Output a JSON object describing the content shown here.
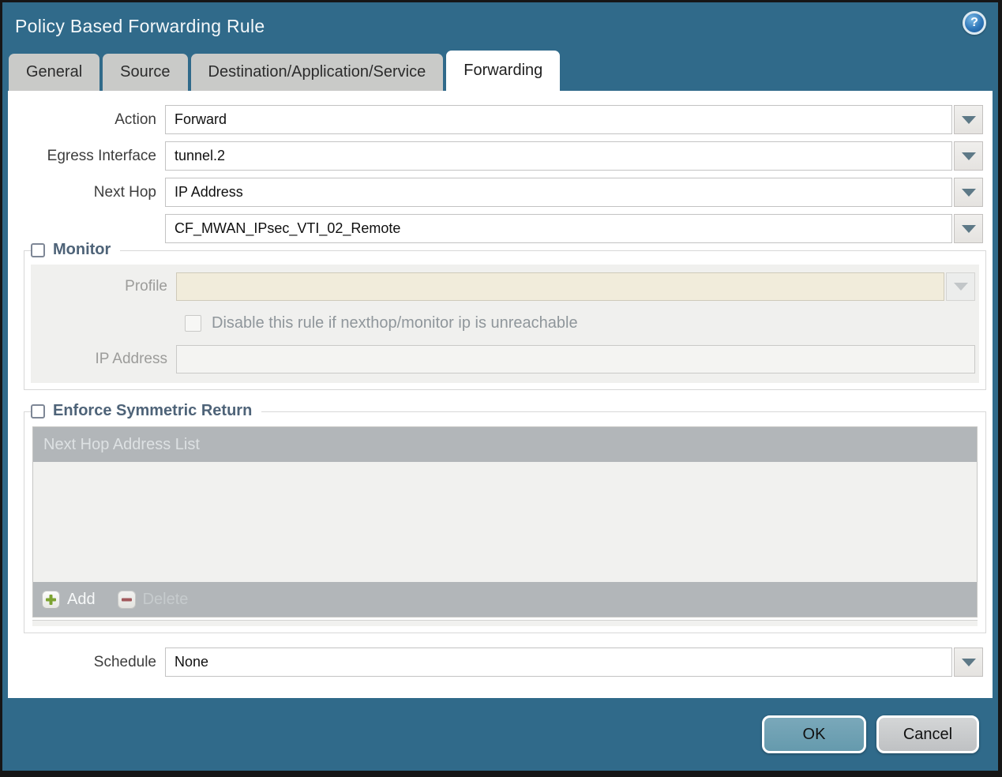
{
  "window": {
    "title": "Policy Based Forwarding Rule",
    "help_glyph": "?",
    "colors": {
      "chrome_teal": "#306a8a",
      "inactive_tab": "#c9cac8",
      "active_tab": "#ffffff",
      "table_header_gray": "#b2b6b9",
      "disabled_beige_field": "#f1ecdb",
      "ok_button": "#6fa1b4",
      "cancel_button": "#c8cacc",
      "legend_text": "#4e6378"
    }
  },
  "tabs": [
    {
      "label": "General",
      "active": false
    },
    {
      "label": "Source",
      "active": false
    },
    {
      "label": "Destination/Application/Service",
      "active": false
    },
    {
      "label": "Forwarding",
      "active": true
    }
  ],
  "form": {
    "action": {
      "label": "Action",
      "value": "Forward"
    },
    "egress_interface": {
      "label": "Egress Interface",
      "value": "tunnel.2"
    },
    "next_hop": {
      "label": "Next Hop",
      "value": "IP Address"
    },
    "next_hop_address": {
      "value": "CF_MWAN_IPsec_VTI_02_Remote"
    },
    "schedule": {
      "label": "Schedule",
      "value": "None"
    }
  },
  "monitor": {
    "legend": "Monitor",
    "checked": false,
    "profile": {
      "label": "Profile",
      "value": ""
    },
    "disable_rule": {
      "label": "Disable this rule if nexthop/monitor ip is unreachable",
      "checked": false
    },
    "ip_address": {
      "label": "IP Address",
      "value": ""
    }
  },
  "enforce_symmetric_return": {
    "legend": "Enforce Symmetric Return",
    "checked": false,
    "table": {
      "header": "Next Hop Address List",
      "rows": []
    },
    "toolbar": {
      "add_label": "Add",
      "delete_label": "Delete"
    }
  },
  "footer": {
    "ok_label": "OK",
    "cancel_label": "Cancel"
  }
}
